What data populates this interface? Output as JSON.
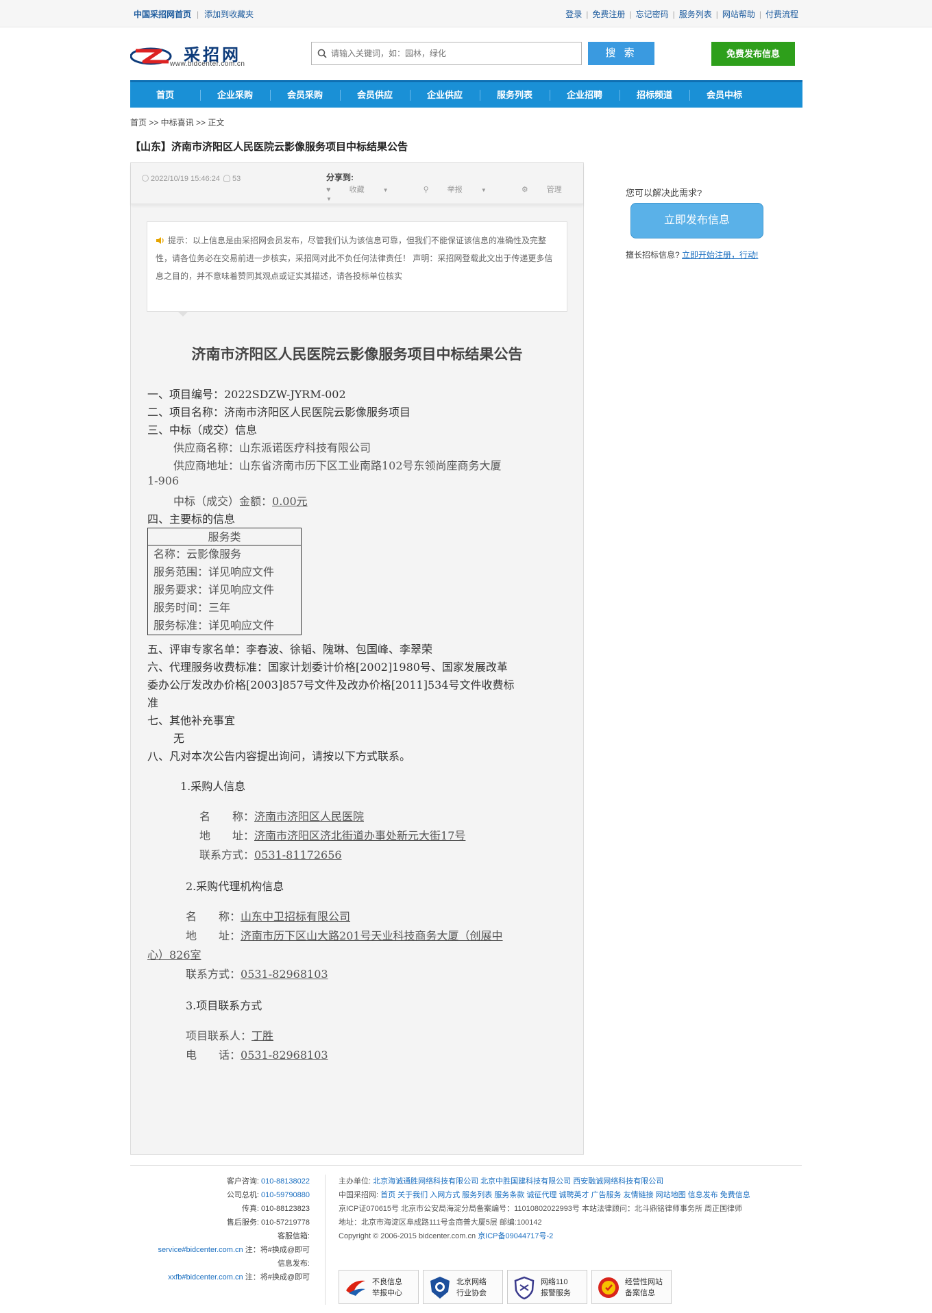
{
  "topbar": {
    "left": [
      "中国采招网首页",
      "添加到收藏夹"
    ],
    "right": [
      "登录",
      "免费注册",
      "忘记密码",
      "服务列表",
      "网站帮助",
      "付费流程"
    ]
  },
  "header": {
    "logo_text": "采招网",
    "logo_url": "www.bidcenter.com.cn",
    "search_placeholder": "请输入关键词，如：园林，绿化",
    "search_button": "搜 索",
    "post_button": "免费发布信息"
  },
  "nav": [
    "首页",
    "企业采购",
    "会员采购",
    "会员供应",
    "企业供应",
    "服务列表",
    "企业招聘",
    "招标频道",
    "会员中标"
  ],
  "breadcrumb": "首页 >> 中标喜讯 >> 正文",
  "page_title": "【山东】济南市济阳区人民医院云影像服务项目中标结果公告",
  "meta": {
    "datetime": "2022/10/19 15:46:24",
    "views": "53",
    "share_label": "分享到:",
    "actions": [
      "收藏",
      "举报",
      "管理"
    ]
  },
  "notice": "提示：以上信息是由采招网会员发布，尽管我们认为该信息可靠，但我们不能保证该信息的准确性及完整性，请各位务必在交易前进一步核实，采招网对此不负任何法律责任！ 声明：采招网登载此文出于传递更多信息之目的，并不意味着赞同其观点或证实其描述，请各投标单位核实",
  "doc": {
    "title": "济南市济阳区人民医院云影像服务项目中标结果公告",
    "l1": "一、项目编号：2022SDZW-JYRM-002",
    "l2": "二、项目名称：济南市济阳区人民医院云影像服务项目",
    "l3": "三、中标（成交）信息",
    "supplier_name": "供应商名称：山东派诺医疗科技有限公司",
    "supplier_addr_a": "供应商地址：山东省济南市历下区工业南路102号东领尚座商务大厦",
    "supplier_addr_b": "1-906",
    "amount_label": "中标（成交）金额：",
    "amount_value": "0.00元",
    "l4": "四、主要标的信息",
    "table_head": "服务类",
    "table_rows": [
      "名称：云影像服务",
      "服务范围：详见响应文件",
      "服务要求：详见响应文件",
      "服务时间：三年",
      "服务标准：详见响应文件"
    ],
    "l5": "五、评审专家名单：李春波、徐韬、隗琳、包国峰、李翠荣",
    "l6a": "六、代理服务收费标准：国家计划委计价格[2002]1980号、国家发展改革",
    "l6b": "委办公厅发改办价格[2003]857号文件及改办价格[2011]534号文件收费标",
    "l6c": "准",
    "l7": "七、其他补充事宜",
    "l7v": "无",
    "l8": "八、凡对本次公告内容提出询问，请按以下方式联系。",
    "s1": "1.采购人信息",
    "s1_name_label": "名　　称：",
    "s1_name": "济南市济阳区人民医院",
    "s1_addr_label": "地　　址：",
    "s1_addr": "济南市济阳区济北街道办事处新元大街17号",
    "s1_tel_label": "联系方式：",
    "s1_tel": "0531-81172656",
    "s2": "2.采购代理机构信息",
    "s2_name_label": "名　　称：",
    "s2_name": "山东中卫招标有限公司",
    "s2_addr_label": "地　　址：",
    "s2_addr_a": "济南市历下区山大路201号天业科技商务大厦（创展中",
    "s2_addr_b": "心）826室",
    "s2_tel_label": "联系方式：",
    "s2_tel": "0531-82968103",
    "s3": "3.项目联系方式",
    "s3_person_label": "项目联系人：",
    "s3_person": "丁胜",
    "s3_tel_label": "电　　话：",
    "s3_tel": "0531-82968103"
  },
  "sidebar": {
    "question": "您可以解决此需求?",
    "button": "立即发布信息",
    "register_prefix": "擅长招标信息?",
    "register_link": "立即开始注册，行动!"
  },
  "footer": {
    "left": [
      {
        "k": "客户咨询:",
        "v": "010-88138022"
      },
      {
        "k": "公司总机:",
        "v": "010-59790880"
      },
      {
        "k": "传真:",
        "v": "010-88123823"
      },
      {
        "k": "售后服务:",
        "v": "010-57219778"
      },
      {
        "k": "客服信箱:",
        "v": ""
      },
      {
        "k": "注：将#换成@即可",
        "v": "service#bidcenter.com.cn"
      },
      {
        "k": "信息发布:",
        "v": ""
      },
      {
        "k": "注：将#换成@即可",
        "v": "xxfb#bidcenter.com.cn"
      }
    ],
    "sponsor_label": "主办单位:",
    "sponsors": "北京海诚通胜网络科技有限公司 北京中胜国建科技有限公司 西安融诚网络科技有限公司",
    "links_label": "中国采招网:",
    "links": "首页 关于我们 入网方式 服务列表 服务条款 诚征代理 诚聘英才 广告服务 友情链接 网站地图 信息发布 免费信息",
    "icp": "京ICP证070615号 北京市公安局海淀分局备案编号：11010802022993号 本站法律顾问：北斗鼎铭律师事务所 周正国律师",
    "address": "地址：北京市海淀区阜成路111号金商普大厦5层 邮编:100142",
    "copyright": "Copyright © 2006-2015 bidcenter.com.cn",
    "icp2": "京ICP备09044717号-2",
    "badges": [
      {
        "l1": "不良信息",
        "l2": "举报中心"
      },
      {
        "l1": "北京网络",
        "l2": "行业协会"
      },
      {
        "l1": "网络110",
        "l2": "报警服务"
      },
      {
        "l1": "经营性网站",
        "l2": "备案信息"
      }
    ]
  }
}
